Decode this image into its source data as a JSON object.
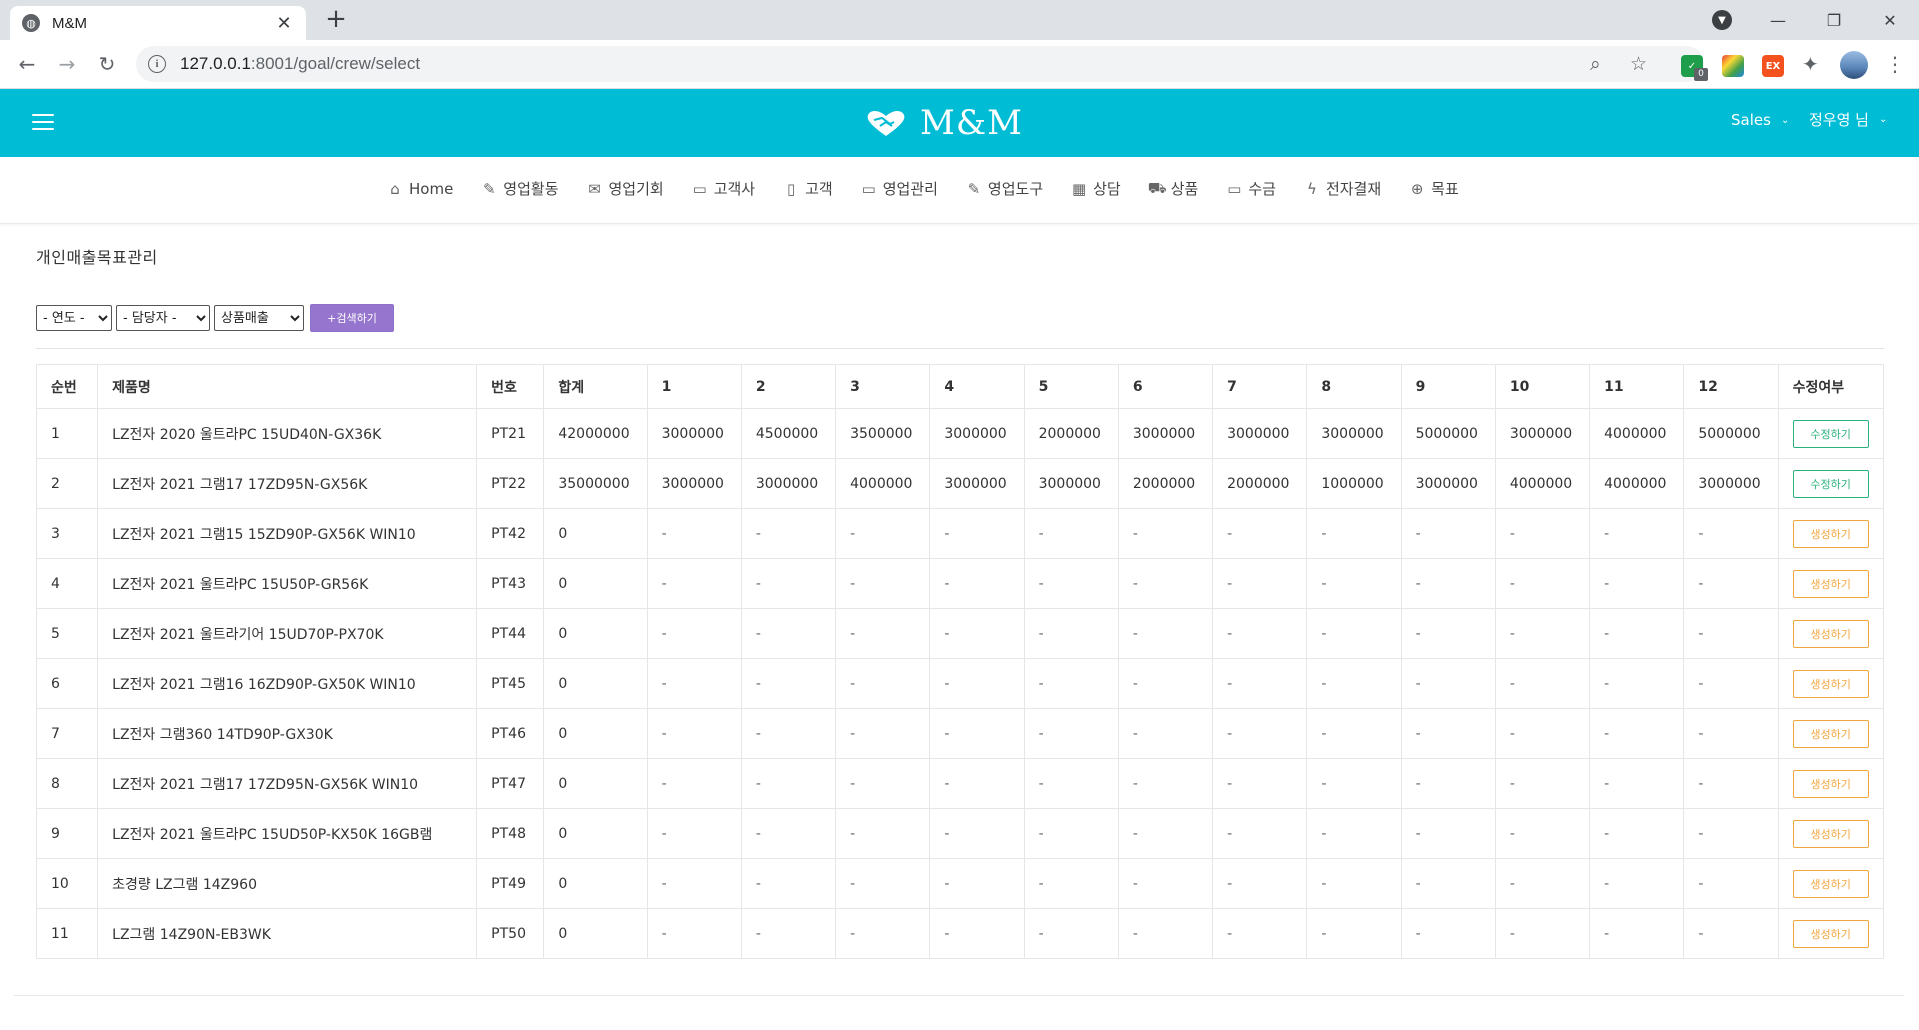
{
  "browser": {
    "tab_title": "M&M",
    "url_host": "127.0.0.1",
    "url_rest": ":8001/goal/crew/select",
    "ext_badge": "0",
    "ext_ex_label": "EX"
  },
  "header": {
    "brand": "M&M",
    "role_dropdown": "Sales",
    "user_dropdown": "정우영 님",
    "brand_color": "#00bcd4"
  },
  "menu": [
    {
      "label": "Home",
      "icon": "home-icon",
      "glyph": "⌂"
    },
    {
      "label": "영업활동",
      "icon": "edit-icon",
      "glyph": "✎"
    },
    {
      "label": "영업기회",
      "icon": "inbox-icon",
      "glyph": "✉"
    },
    {
      "label": "고객사",
      "icon": "folder-icon",
      "glyph": "▭"
    },
    {
      "label": "고객",
      "icon": "mobile-icon",
      "glyph": "▯"
    },
    {
      "label": "영업관리",
      "icon": "monitor-icon",
      "glyph": "▭"
    },
    {
      "label": "영업도구",
      "icon": "edit-icon",
      "glyph": "✎"
    },
    {
      "label": "상담",
      "icon": "grid-icon",
      "glyph": "▦"
    },
    {
      "label": "상품",
      "icon": "cart-icon",
      "glyph": "⛟"
    },
    {
      "label": "수금",
      "icon": "folder-open-icon",
      "glyph": "▭"
    },
    {
      "label": "전자결재",
      "icon": "bolt-icon",
      "glyph": "ϟ"
    },
    {
      "label": "목표",
      "icon": "target-icon",
      "glyph": "⊕"
    }
  ],
  "page": {
    "title": "개인매출목표관리",
    "filters": {
      "year": "- 연도 -",
      "manager": "- 담당자 -",
      "type": "상품매출",
      "search_button": "+검색하기"
    }
  },
  "table": {
    "headers": [
      "순번",
      "제품명",
      "번호",
      "합계",
      "1",
      "2",
      "3",
      "4",
      "5",
      "6",
      "7",
      "8",
      "9",
      "10",
      "11",
      "12",
      "수정여부"
    ],
    "rows": [
      {
        "no": "1",
        "name": "LZ전자 2020 울트라PC 15UD40N-GX36K",
        "code": "PT21",
        "total": "42000000",
        "months": [
          "3000000",
          "4500000",
          "3500000",
          "3000000",
          "2000000",
          "3000000",
          "3000000",
          "3000000",
          "5000000",
          "3000000",
          "4000000",
          "5000000"
        ],
        "action": "수정하기",
        "action_type": "edit"
      },
      {
        "no": "2",
        "name": "LZ전자 2021 그램17 17ZD95N-GX56K",
        "code": "PT22",
        "total": "35000000",
        "months": [
          "3000000",
          "3000000",
          "4000000",
          "3000000",
          "3000000",
          "2000000",
          "2000000",
          "1000000",
          "3000000",
          "4000000",
          "4000000",
          "3000000"
        ],
        "action": "수정하기",
        "action_type": "edit"
      },
      {
        "no": "3",
        "name": "LZ전자 2021 그램15 15ZD90P-GX56K WIN10",
        "code": "PT42",
        "total": "0",
        "months": [
          "-",
          "-",
          "-",
          "-",
          "-",
          "-",
          "-",
          "-",
          "-",
          "-",
          "-",
          "-"
        ],
        "action": "생성하기",
        "action_type": "create"
      },
      {
        "no": "4",
        "name": "LZ전자 2021 울트라PC 15U50P-GR56K",
        "code": "PT43",
        "total": "0",
        "months": [
          "-",
          "-",
          "-",
          "-",
          "-",
          "-",
          "-",
          "-",
          "-",
          "-",
          "-",
          "-"
        ],
        "action": "생성하기",
        "action_type": "create"
      },
      {
        "no": "5",
        "name": "LZ전자 2021 울트라기어 15UD70P-PX70K",
        "code": "PT44",
        "total": "0",
        "months": [
          "-",
          "-",
          "-",
          "-",
          "-",
          "-",
          "-",
          "-",
          "-",
          "-",
          "-",
          "-"
        ],
        "action": "생성하기",
        "action_type": "create"
      },
      {
        "no": "6",
        "name": "LZ전자 2021 그램16 16ZD90P-GX50K WIN10",
        "code": "PT45",
        "total": "0",
        "months": [
          "-",
          "-",
          "-",
          "-",
          "-",
          "-",
          "-",
          "-",
          "-",
          "-",
          "-",
          "-"
        ],
        "action": "생성하기",
        "action_type": "create"
      },
      {
        "no": "7",
        "name": "LZ전자 그램360 14TD90P-GX30K",
        "code": "PT46",
        "total": "0",
        "months": [
          "-",
          "-",
          "-",
          "-",
          "-",
          "-",
          "-",
          "-",
          "-",
          "-",
          "-",
          "-"
        ],
        "action": "생성하기",
        "action_type": "create"
      },
      {
        "no": "8",
        "name": "LZ전자 2021 그램17 17ZD95N-GX56K WIN10",
        "code": "PT47",
        "total": "0",
        "months": [
          "-",
          "-",
          "-",
          "-",
          "-",
          "-",
          "-",
          "-",
          "-",
          "-",
          "-",
          "-"
        ],
        "action": "생성하기",
        "action_type": "create"
      },
      {
        "no": "9",
        "name": "LZ전자 2021 울트라PC 15UD50P-KX50K 16GB램",
        "code": "PT48",
        "total": "0",
        "months": [
          "-",
          "-",
          "-",
          "-",
          "-",
          "-",
          "-",
          "-",
          "-",
          "-",
          "-",
          "-"
        ],
        "action": "생성하기",
        "action_type": "create"
      },
      {
        "no": "10",
        "name": "초경량 LZ그램 14Z960",
        "code": "PT49",
        "total": "0",
        "months": [
          "-",
          "-",
          "-",
          "-",
          "-",
          "-",
          "-",
          "-",
          "-",
          "-",
          "-",
          "-"
        ],
        "action": "생성하기",
        "action_type": "create"
      },
      {
        "no": "11",
        "name": "LZ그램 14Z90N-EB3WK",
        "code": "PT50",
        "total": "0",
        "months": [
          "-",
          "-",
          "-",
          "-",
          "-",
          "-",
          "-",
          "-",
          "-",
          "-",
          "-",
          "-"
        ],
        "action": "생성하기",
        "action_type": "create"
      }
    ]
  }
}
